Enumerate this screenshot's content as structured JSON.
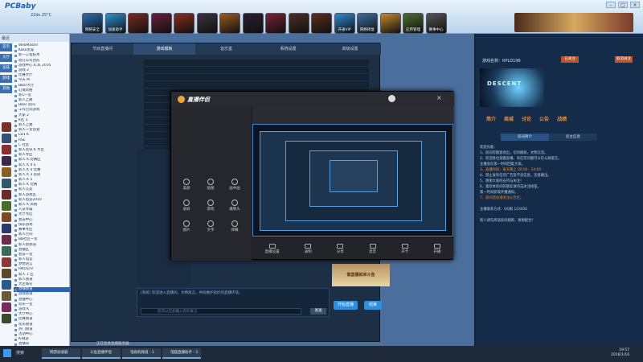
{
  "app": {
    "logo_text": "PCBaby",
    "user_label": "22ds 25°C"
  },
  "top_tiles": [
    {
      "label": "网络安全",
      "color": "#2b6fb3"
    },
    {
      "label": "加速助手",
      "color": "#2f8fd0"
    },
    {
      "label": "",
      "color": "#7b2a22"
    },
    {
      "label": "",
      "color": "#6a1f3a"
    },
    {
      "label": "",
      "color": "#8a2d1a"
    },
    {
      "label": "",
      "color": "#3a3340"
    },
    {
      "label": "",
      "color": "#9a5a1c"
    },
    {
      "label": "",
      "color": "#2a2030"
    },
    {
      "label": "",
      "color": "#7a2234"
    },
    {
      "label": "",
      "color": "#4b2f25"
    },
    {
      "label": "",
      "color": "#5a3020"
    },
    {
      "label": "开通VIP",
      "color": "#2f88cf"
    },
    {
      "label": "网络修复",
      "color": "#3a6fa0"
    },
    {
      "label": "",
      "color": "#c48a2a"
    },
    {
      "label": "应用管理",
      "color": "#4b6f2a"
    },
    {
      "label": "赛事中心",
      "color": "#555"
    }
  ],
  "sidebar": {
    "header": "最近",
    "tabs": [
      "首页",
      "大厅",
      "竞技",
      "游戏",
      "其他"
    ],
    "game_icon_colors": [
      "#7a3022",
      "#36507a",
      "#8a2e2e",
      "#3a2a50",
      "#8a6020",
      "#2e5a6a",
      "#6a2a2a",
      "#4a6a2a",
      "#7a4a20",
      "#2a3a6a",
      "#6a2a4a",
      "#3a6a5a",
      "#8a3a3a",
      "#5a4a2a",
      "#2a5a8a",
      "#6a5a3a",
      "#7a2a5a",
      "#3a4a2a"
    ],
    "channels": [
      "WebMaster",
      "Koko黑鬼",
      "新一工程技术",
      "现在公司团队",
      "游戏中心 K.风 2016",
      "游戏 2",
      "比赛大厅",
      "今天 M",
      "BBar大厅",
      "心情风格",
      "新1一室",
      "新人上路",
      "BBar 房间",
      "工作空间游戏",
      "大家 2",
      "K区 3",
      "新人上路",
      "新人一室监管",
      "LD1 K",
      "RSE",
      "C 社区",
      "新人资讯 K 专区",
      "新人专区",
      "新人 K.比赛区",
      "新人 K 4 S",
      "新人 K 4 比赛",
      "新人 K 3 房间",
      "新人 K 5",
      "新人 K 比赛",
      "新人交友",
      "新人游戏区",
      "新人电竞2016",
      "新人 K 风格",
      "人员专属",
      "大厅专区",
      "会员中心",
      "快乐游戏",
      "赛事专区",
      "新人空间",
      "BB社区一室",
      "新人新频道",
      "直播区",
      "会员一室",
      "新人电竞",
      "梦想语言",
      "RND公众",
      "新人 1 区",
      "新人频道",
      "大区域名",
      "直播频道",
      "游戏频道",
      "直播中心",
      "欢乐一室",
      "游戏 K",
      "大厅中心",
      "比赛频道",
      "欢乐频道",
      "热门频道",
      "活动中心",
      "K-网游",
      "直播间",
      "直播 3"
    ],
    "selected_index": 49
  },
  "studio": {
    "tabs": [
      "节目直播间",
      "游戏模板",
      "音乐盒",
      "系统设置",
      "高级设置"
    ],
    "active_tab": 1,
    "chat_message": "[系统] 欢迎进入直播间，文明发言，共同维护良好的直播环境。",
    "chat_placeholder": "您可以在此输入您的发言",
    "send_label": "发送",
    "record_label": "开始直播",
    "stop_label": "结束",
    "ad_text": "做直播就来斗鱼"
  },
  "overlay": {
    "brand": "直播伴侣",
    "menu_items": [
      "美颜",
      "贴图",
      "画中画",
      "录屏",
      "游戏",
      "摄像头",
      "图片",
      "文字",
      "弹幕"
    ],
    "bottom_buttons": [
      "直播设置",
      "录制",
      "分享",
      "混音",
      "声卡",
      "开播"
    ]
  },
  "right_panel": {
    "title": "游戏名称：RPLD196",
    "btn_a": "已关注",
    "btn_b": "取消关注",
    "brand": "DESCENT",
    "tabs": [
      "简介",
      "商城",
      "讨论",
      "公告",
      "战绩"
    ],
    "segments": [
      "房间简介",
      "房主信息"
    ],
    "lines": [
      {
        "t": "欢迎光临：",
        "hl": false
      },
      {
        "t": "1、房间可随意进出，切勿刷屏，文明交流。",
        "hl": false
      },
      {
        "t": "2、欢迎各位观看直播，有任何问题可以在公屏留言，",
        "hl": false
      },
      {
        "t": "   主播会在第一时间回复大家。",
        "hl": false
      },
      {
        "t": "3、直播时间：每天晚上 20:00 - 24:00",
        "hl": true
      },
      {
        "t": "4、禁止发布任何广告及不良信息，违者踢出。",
        "hl": false
      },
      {
        "t": "5、感谢大家的支持与关注！",
        "hl": false
      },
      {
        "t": "6、喜欢本房间的朋友请点击关注按钮，",
        "hl": false
      },
      {
        "t": "   第一时间获取开播通知。",
        "hl": false
      },
      {
        "t": "7、房间活动请关注公告栏。",
        "hl": true
      },
      {
        "t": "",
        "hl": false
      },
      {
        "t": "主播联系方式：QQ群 123456",
        "hl": false
      },
      {
        "t": "",
        "hl": false
      },
      {
        "t": "新人请先阅读房间规则，谢谢配合！",
        "hl": false
      }
    ]
  },
  "taskbar": {
    "search": "搜索",
    "tasks": [
      "网游加速器",
      "斗鱼直播伴侣",
      "电视机频道 - 1",
      "电脑直播助手 - 1"
    ],
    "clock": "19:57",
    "date": "2016/1/16",
    "status": "正在连接直播服务器…"
  }
}
